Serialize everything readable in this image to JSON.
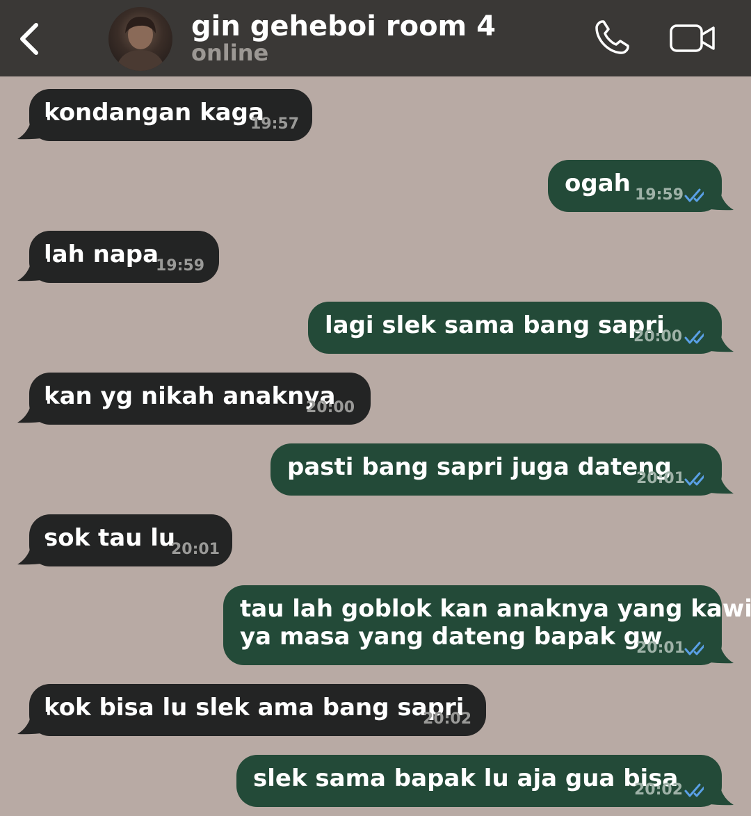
{
  "header": {
    "contact_name": "gin geheboi room 4",
    "status": "online",
    "icons": [
      "back-chevron-icon",
      "avatar-photo",
      "phone-icon",
      "video-camera-icon"
    ]
  },
  "colors": {
    "header_bg": "#3a3836",
    "chat_bg": "#b8aaa4",
    "incoming_bubble": "#232424",
    "outgoing_bubble": "#234a38",
    "read_ticks": "#5aa0e6"
  },
  "messages": [
    {
      "direction": "incoming",
      "text": "kondangan kaga",
      "time": "19:57"
    },
    {
      "direction": "outgoing",
      "text": "ogah",
      "time": "19:59",
      "read": true
    },
    {
      "direction": "incoming",
      "text": "lah napa",
      "time": "19:59"
    },
    {
      "direction": "outgoing",
      "text": "lagi slek sama bang sapri",
      "time": "20:00",
      "read": true
    },
    {
      "direction": "incoming",
      "text": "kan yg nikah anaknya",
      "time": "20:00"
    },
    {
      "direction": "outgoing",
      "text": "pasti bang sapri juga dateng",
      "time": "20:01",
      "read": true
    },
    {
      "direction": "incoming",
      "text": "sok tau lu",
      "time": "20:01"
    },
    {
      "direction": "outgoing",
      "text": "tau lah goblok kan anaknya yang kawin\nya masa yang dateng bapak gw",
      "time": "20:01",
      "read": true
    },
    {
      "direction": "incoming",
      "text": "kok bisa lu slek ama bang sapri",
      "time": "20:02"
    },
    {
      "direction": "outgoing",
      "text": "slek sama bapak lu aja gua bisa",
      "time": "20:02",
      "read": true
    }
  ]
}
